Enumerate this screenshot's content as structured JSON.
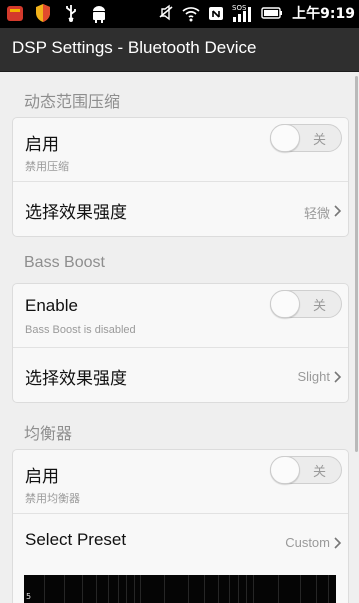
{
  "status_bar": {
    "time": "上午9:19",
    "icons": [
      "notification-red-icon",
      "shield-icon",
      "usb-icon",
      "android-icon",
      "mute-icon",
      "wifi-icon",
      "nfc-icon",
      "signal-sos-icon",
      "battery-icon"
    ],
    "sos": "SOS"
  },
  "action_bar": {
    "title": "DSP Settings - Bluetooth Device"
  },
  "sections": {
    "drc": {
      "header": "动态范围压缩",
      "enable_title": "启用",
      "enable_sub": "禁用压缩",
      "toggle_label": "关",
      "strength_title": "选择效果强度",
      "strength_value": "轻微"
    },
    "bass": {
      "header": "Bass Boost",
      "enable_title": "Enable",
      "enable_sub": "Bass Boost is disabled",
      "toggle_label": "关",
      "strength_title": "选择效果强度",
      "strength_value": "Slight"
    },
    "eq": {
      "header": "均衡器",
      "enable_title": "启用",
      "enable_sub": "禁用均衡器",
      "toggle_label": "关",
      "preset_title": "Select Preset",
      "preset_value": "Custom",
      "graph_mark": "5"
    }
  },
  "colors": {
    "status_bg": "#000000",
    "actionbar_bg": "#2f2f2f",
    "page_bg": "#efefef",
    "card_bg": "#f8f8f8"
  }
}
